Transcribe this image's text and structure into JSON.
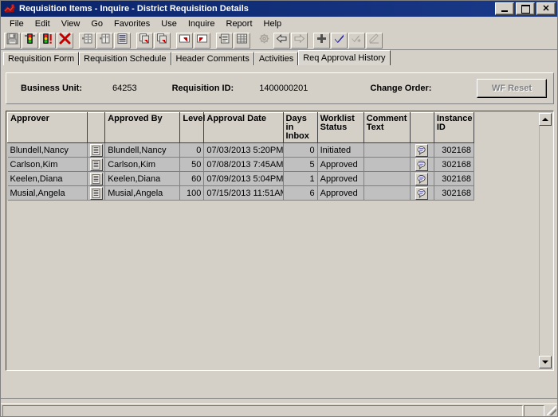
{
  "window": {
    "title": "Requisition Items - Inquire - District Requisition Details",
    "icon": "app-icon",
    "minimize_label": "_",
    "maximize_label": "□",
    "close_label": "✕"
  },
  "menubar": {
    "items": [
      {
        "label": "File"
      },
      {
        "label": "Edit"
      },
      {
        "label": "View"
      },
      {
        "label": "Go"
      },
      {
        "label": "Favorites"
      },
      {
        "label": "Use"
      },
      {
        "label": "Inquire"
      },
      {
        "label": "Report"
      },
      {
        "label": "Help"
      }
    ]
  },
  "toolbar": {
    "buttons": [
      {
        "name": "save-icon",
        "kind": "save"
      },
      {
        "name": "traffic-light-icon",
        "kind": "traffic"
      },
      {
        "name": "traffic-light-alert-icon",
        "kind": "traffic-alert"
      },
      {
        "name": "cancel-red-x-icon",
        "kind": "redx"
      },
      {
        "sep": true
      },
      {
        "name": "insert-row-icon",
        "kind": "insert-row"
      },
      {
        "name": "delete-row-icon",
        "kind": "delete-row"
      },
      {
        "name": "list-icon",
        "kind": "list"
      },
      {
        "sep": true
      },
      {
        "name": "copy-icon",
        "kind": "copy"
      },
      {
        "name": "paste-icon",
        "kind": "paste"
      },
      {
        "sep": true
      },
      {
        "name": "next-in-list-icon",
        "kind": "nextlist"
      },
      {
        "name": "previous-in-list-icon",
        "kind": "prevlist"
      },
      {
        "sep": true
      },
      {
        "name": "spell-check-icon",
        "kind": "spell"
      },
      {
        "name": "grid-export-icon",
        "kind": "gridexport"
      },
      {
        "sep": true
      },
      {
        "name": "process-monitor-icon",
        "kind": "gear"
      },
      {
        "name": "back-arrow-icon",
        "kind": "back"
      },
      {
        "name": "forward-arrow-icon",
        "kind": "forward"
      },
      {
        "sep": true
      },
      {
        "name": "add-plus-icon",
        "kind": "plus"
      },
      {
        "name": "check-icon",
        "kind": "check"
      },
      {
        "name": "check-all-icon",
        "kind": "checkall"
      },
      {
        "name": "notepad-icon",
        "kind": "notepad"
      }
    ]
  },
  "tabs": [
    {
      "label": "Requisition Form",
      "active": false
    },
    {
      "label": "Requisition Schedule",
      "active": false
    },
    {
      "label": "Header Comments",
      "active": false
    },
    {
      "label": "Activities",
      "active": false
    },
    {
      "label": "Req Approval History",
      "active": true
    }
  ],
  "header_panel": {
    "business_unit_label": "Business Unit:",
    "business_unit_value": "64253",
    "requisition_id_label": "Requisition ID:",
    "requisition_id_value": "1400000201",
    "change_order_label": "Change Order:",
    "change_order_value": "",
    "wf_reset_label": "WF Reset"
  },
  "grid": {
    "columns": [
      {
        "key": "approver",
        "label": "Approver"
      },
      {
        "key": "detail_btn",
        "label": ""
      },
      {
        "key": "approved_by",
        "label": "Approved By"
      },
      {
        "key": "level",
        "label": "Level"
      },
      {
        "key": "approval_date",
        "label": "Approval Date"
      },
      {
        "key": "days_in_inbox",
        "label": "Days in\nInbox"
      },
      {
        "key": "worklist_status",
        "label": "Worklist\nStatus"
      },
      {
        "key": "comment_text",
        "label": "Comment\nText"
      },
      {
        "key": "comment_btn",
        "label": ""
      },
      {
        "key": "instance_id",
        "label": "Instance\nID"
      }
    ],
    "rows": [
      {
        "approver": "Blundell,Nancy",
        "approved_by": "Blundell,Nancy",
        "level": "0",
        "approval_date": "07/03/2013 5:20PM",
        "days_in_inbox": "0",
        "worklist_status": "Initiated",
        "comment_text": "",
        "instance_id": "302168"
      },
      {
        "approver": "Carlson,Kim",
        "approved_by": "Carlson,Kim",
        "level": "50",
        "approval_date": "07/08/2013 7:45AM",
        "days_in_inbox": "5",
        "worklist_status": "Approved",
        "comment_text": "",
        "instance_id": "302168"
      },
      {
        "approver": "Keelen,Diana",
        "approved_by": "Keelen,Diana",
        "level": "60",
        "approval_date": "07/09/2013 5:04PM",
        "days_in_inbox": "1",
        "worklist_status": "Approved",
        "comment_text": "",
        "instance_id": "302168"
      },
      {
        "approver": "Musial,Angela",
        "approved_by": "Musial,Angela",
        "level": "100",
        "approval_date": "07/15/2013 11:51AM",
        "days_in_inbox": "6",
        "worklist_status": "Approved",
        "comment_text": "",
        "instance_id": "302168"
      }
    ],
    "row_button_icon": "document-lines-icon",
    "comment_button_icon": "comment-bubble-icon",
    "scrollbar": {
      "up_icon": "scroll-up-arrow-icon",
      "down_icon": "scroll-down-arrow-icon"
    }
  },
  "statusbar": {
    "message": "",
    "resize_grip_icon": "resize-grip-icon"
  },
  "colors": {
    "window_face": "#d4d0c8",
    "title_bar": "#000080",
    "grid_cell": "#c0c0c0",
    "text": "#000000",
    "disabled_text": "#808080"
  }
}
